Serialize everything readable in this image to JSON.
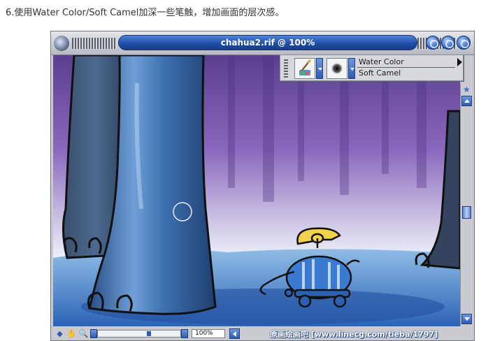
{
  "caption": "6.使用Water Color/Soft Camel加深一些笔触，增加画面的层次感。",
  "window": {
    "title": "chahua2.rif @ 100%"
  },
  "brush": {
    "category": "Water Color",
    "variant": "Soft Camel"
  },
  "status": {
    "zoom": "100%"
  },
  "watermark": "原画绘画吧 [www.linecg.com/tieba/1797]",
  "icons": {
    "app": "painter-logo-icon",
    "category": "brush-category-icon",
    "variant": "brush-variant-icon",
    "more": "triangle-right-icon",
    "window_controls": [
      "minimize-icon",
      "maximize-icon",
      "close-icon"
    ]
  },
  "colors": {
    "title_pill": "#1f4fa6",
    "chrome": "#c9cbd1",
    "accent_button": "#2b5bb3"
  }
}
